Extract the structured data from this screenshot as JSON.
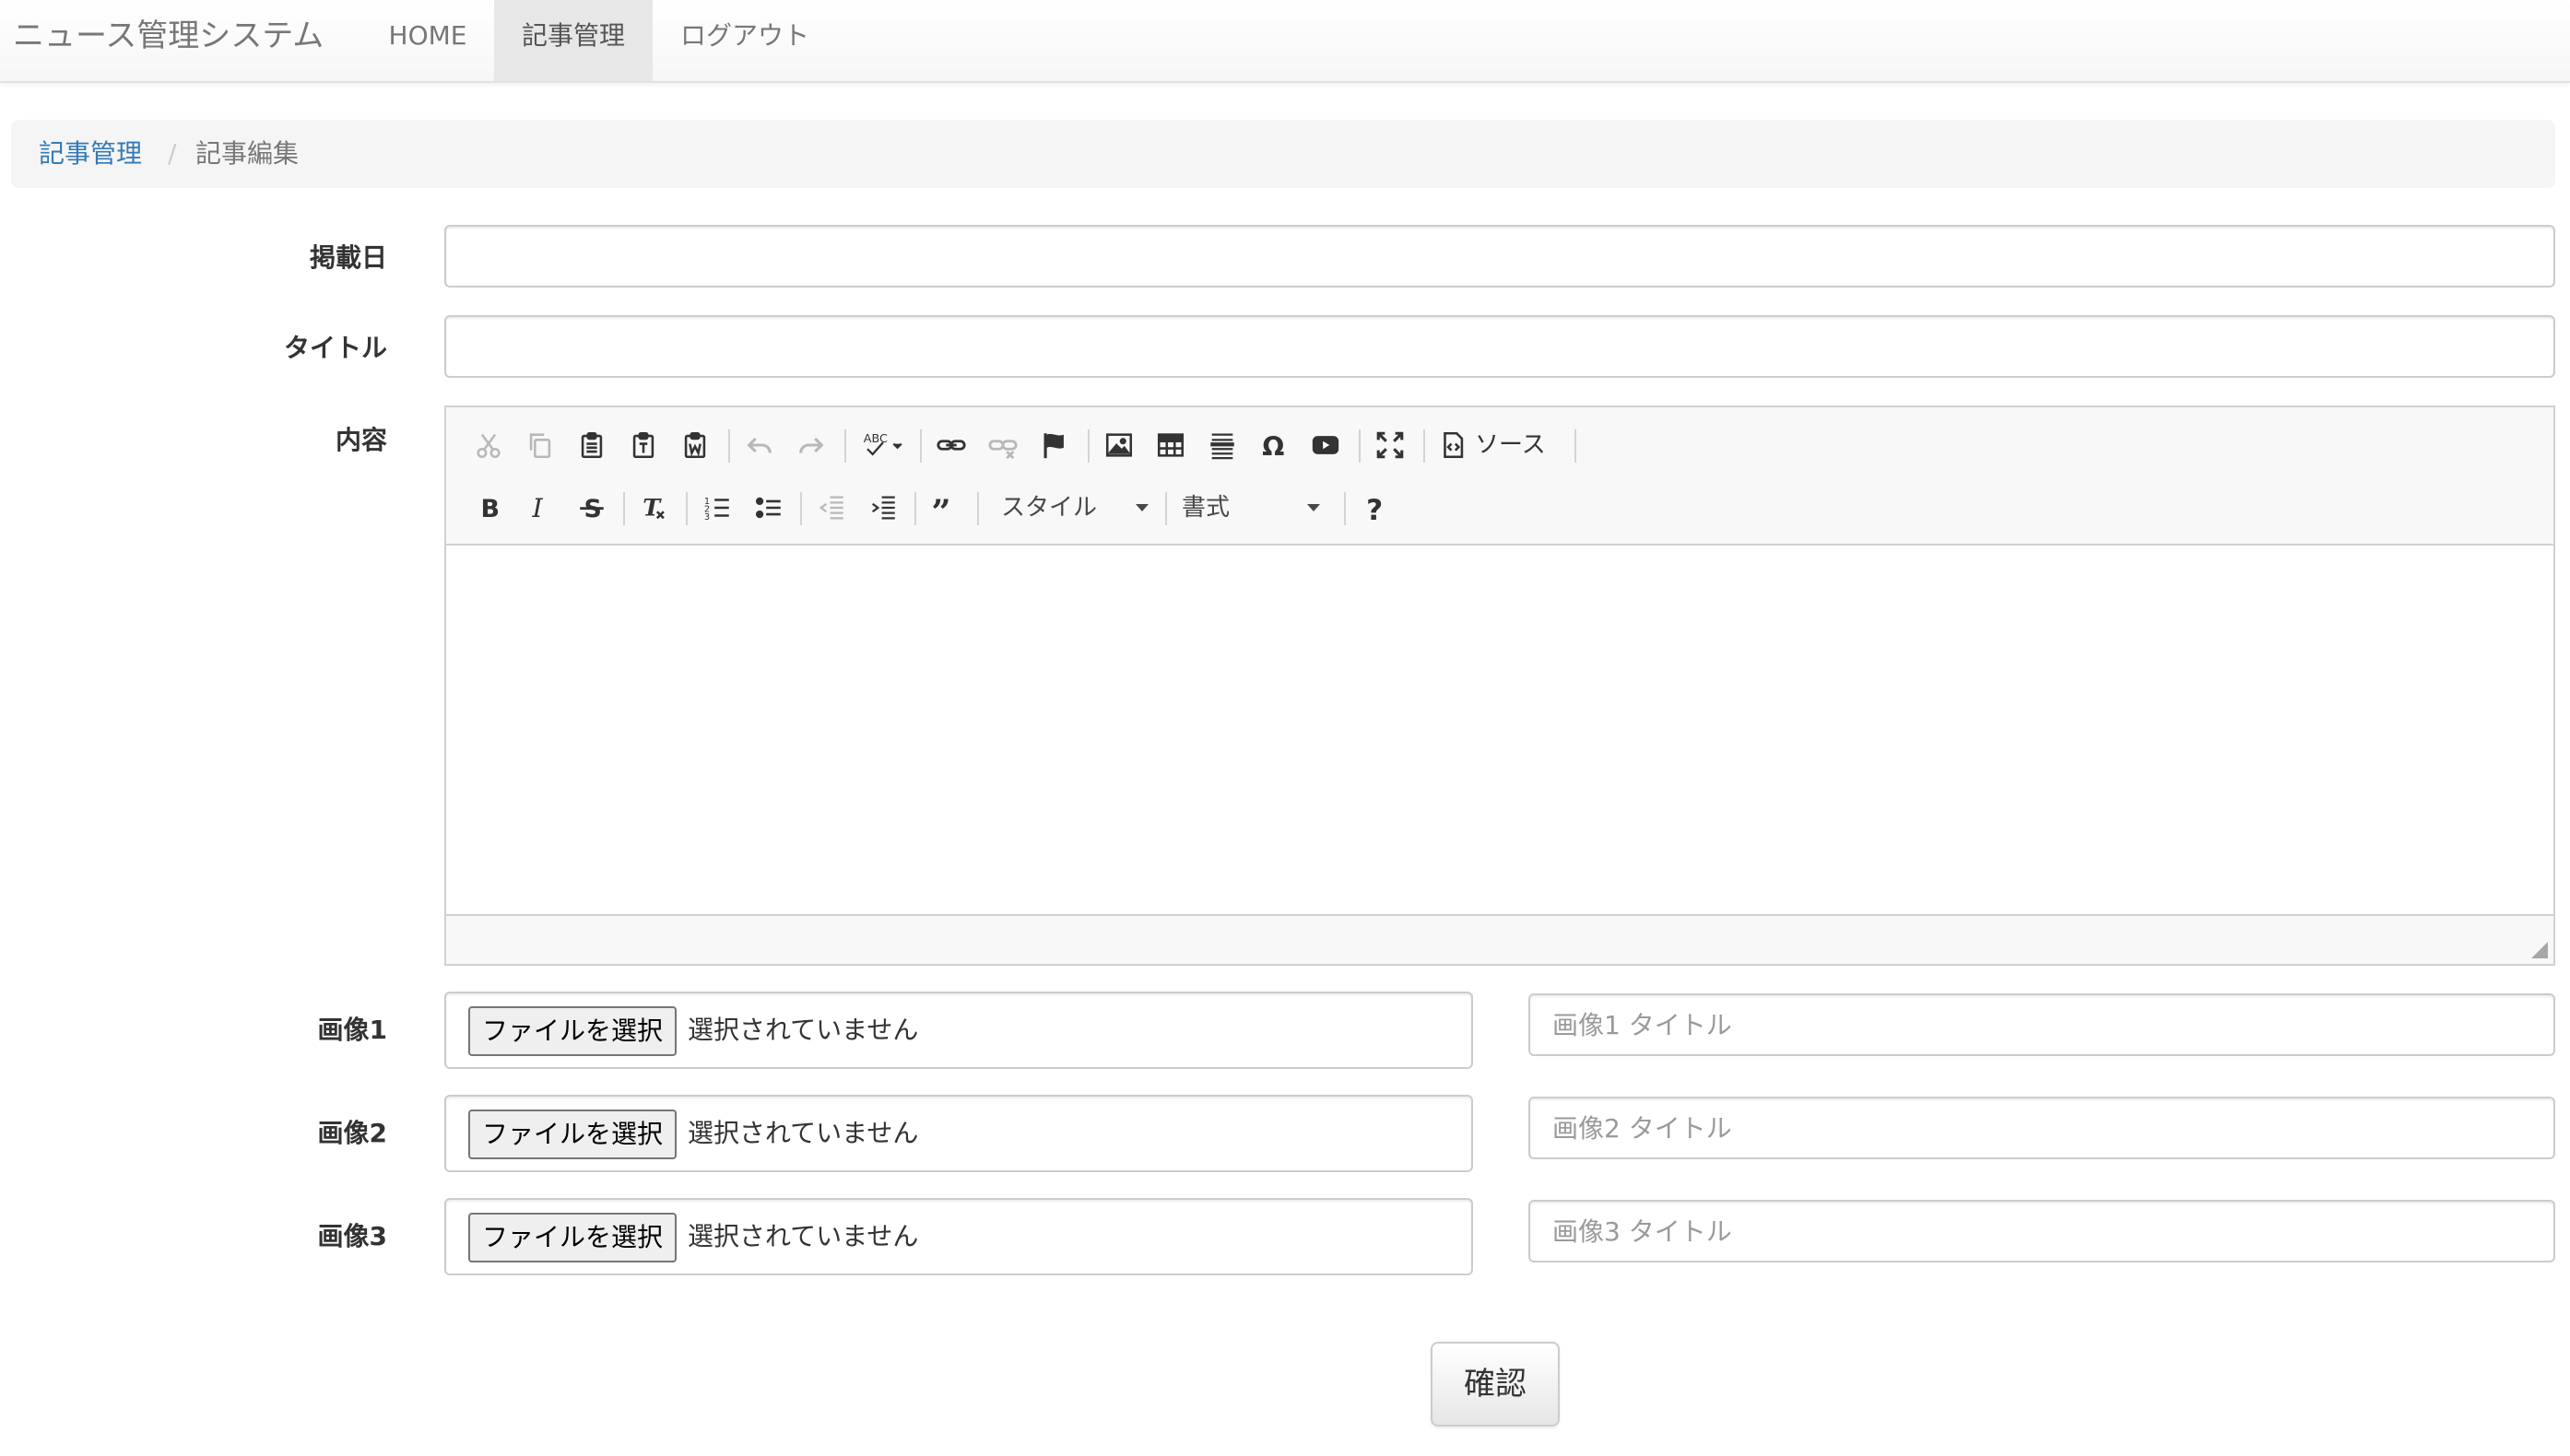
{
  "navbar": {
    "brand": "ニュース管理システム",
    "items": [
      {
        "label": "HOME",
        "active": false
      },
      {
        "label": "記事管理",
        "active": true
      },
      {
        "label": "ログアウト",
        "active": false
      }
    ]
  },
  "breadcrumb": {
    "link": "記事管理",
    "separator": "/",
    "current": "記事編集"
  },
  "form": {
    "date": {
      "label": "掲載日",
      "value": ""
    },
    "title": {
      "label": "タイトル",
      "value": ""
    },
    "content": {
      "label": "内容",
      "source_label": "ソース",
      "style_combo": "スタイル",
      "format_combo": "書式",
      "body": ""
    },
    "images": [
      {
        "label": "画像1",
        "button": "ファイルを選択",
        "status": "選択されていません",
        "title_placeholder": "画像1 タイトル"
      },
      {
        "label": "画像2",
        "button": "ファイルを選択",
        "status": "選択されていません",
        "title_placeholder": "画像2 タイトル"
      },
      {
        "label": "画像3",
        "button": "ファイルを選択",
        "status": "選択されていません",
        "title_placeholder": "画像3 タイトル"
      }
    ],
    "submit_label": "確認"
  },
  "colors": {
    "link": "#337ab7",
    "nav_active_bg": "#e7e7e7",
    "toolbar_bg": "#f8f8f8",
    "input_border": "#cccccc"
  },
  "editor_toolbar_icons": [
    "cut-icon",
    "copy-icon",
    "paste-icon",
    "paste-text-icon",
    "paste-word-icon",
    "undo-icon",
    "redo-icon",
    "spellcheck-icon",
    "link-icon",
    "unlink-icon",
    "anchor-icon",
    "image-icon",
    "table-icon",
    "horizontal-rule-icon",
    "special-char-icon",
    "youtube-icon",
    "maximize-icon",
    "source-icon",
    "bold-icon",
    "italic-icon",
    "strike-icon",
    "remove-format-icon",
    "numbered-list-icon",
    "bulleted-list-icon",
    "outdent-icon",
    "indent-icon",
    "blockquote-icon",
    "help-icon"
  ]
}
